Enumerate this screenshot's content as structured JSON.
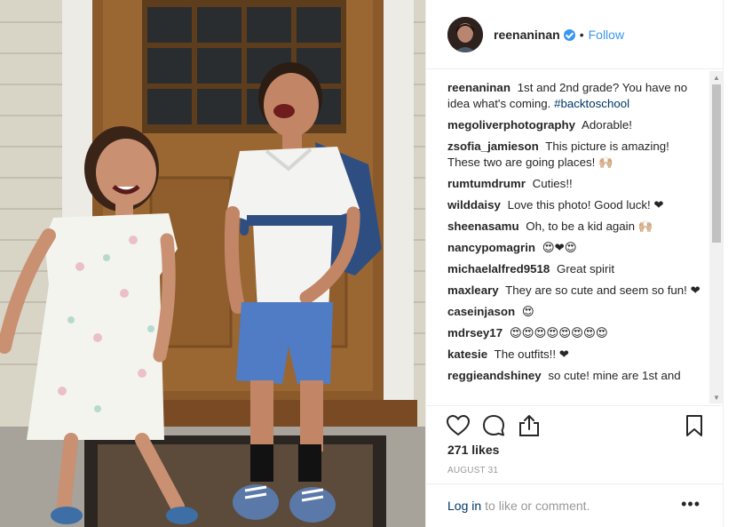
{
  "post": {
    "author": "reenaninan",
    "separator": "•",
    "follow_label": "Follow",
    "likes": "271 likes",
    "date": "AUGUST 31",
    "login_link": "Log in",
    "login_suffix": "to like or comment.",
    "more_label": "•••"
  },
  "caption": {
    "user": "reenaninan",
    "text": "1st and 2nd grade? You have no idea what's coming.",
    "hashtag": "#backtoschool"
  },
  "comments": [
    {
      "user": "megoliverphotography",
      "text": "Adorable!"
    },
    {
      "user": "zsofia_jamieson",
      "text": "This picture is amazing! These two are going places! 🙌🏼"
    },
    {
      "user": "rumtumdrumr",
      "text": "Cuties!!"
    },
    {
      "user": "wilddaisy",
      "text": "Love this photo! Good luck! ❤"
    },
    {
      "user": "sheenasamu",
      "text": "Oh, to be a kid again 🙌🏼"
    },
    {
      "user": "nancypomagrin",
      "text": "😍❤😍"
    },
    {
      "user": "michaelalfred9518",
      "text": "Great spirit"
    },
    {
      "user": "maxleary",
      "text": "They are so cute and seem so fun! ❤"
    },
    {
      "user": "caseinjason",
      "text": "😍"
    },
    {
      "user": "mdrsey17",
      "text": "😍😍😍😍😍😍😍😍"
    },
    {
      "user": "katesie",
      "text": "The outfits!! ❤"
    },
    {
      "user": "reggieandshiney",
      "text": "so cute! mine are 1st and"
    }
  ],
  "icons": {
    "like": "heart-icon",
    "comment": "comment-icon",
    "share": "share-icon",
    "save": "bookmark-icon"
  },
  "colors": {
    "link_blue": "#3897f0",
    "hashtag": "#003569",
    "muted": "#999999"
  }
}
